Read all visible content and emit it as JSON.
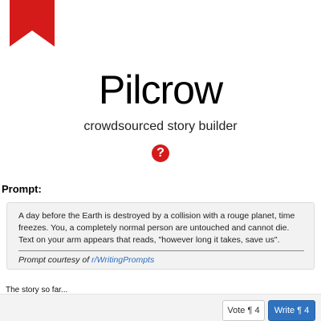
{
  "colors": {
    "ribbon": "#d51a1a",
    "help_icon": "#d51a1a",
    "link": "#2a6fbf",
    "write_button": "#2f72c0"
  },
  "header": {
    "title": "Pilcrow",
    "subtitle": "crowdsourced story builder",
    "help_icon": "question-circle",
    "help_glyph": "?"
  },
  "prompt": {
    "heading": "Prompt:",
    "text": "A day before the Earth is destroyed by a collision with a rouge planet, time freezes. You, a completely normal person are untouched and cannot die. Text on your arm appears that reads, \"however long it takes, save us\".",
    "credit_prefix": "Prompt courtesy of ",
    "credit_link": "r/WritingPrompts"
  },
  "story": {
    "label": "The story so far..."
  },
  "footer": {
    "vote_label": "Vote ¶ 4",
    "write_label": "Write ¶ 4"
  }
}
